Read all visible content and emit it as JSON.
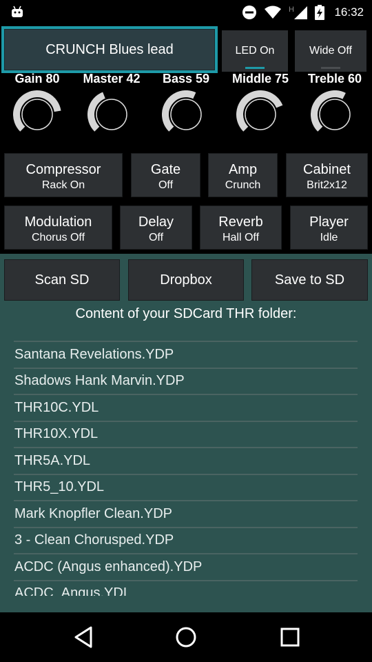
{
  "status": {
    "time": "16:32",
    "net_letter": "H"
  },
  "preset": {
    "label": "CRUNCH Blues lead"
  },
  "toggles": [
    {
      "label": "LED On",
      "indicator": "#1e9aa8"
    },
    {
      "label": "Wide Off",
      "indicator": "#4a4d50"
    }
  ],
  "knobs": [
    {
      "label": "Gain 80",
      "value": 80
    },
    {
      "label": "Master 42",
      "value": 42
    },
    {
      "label": "Bass 59",
      "value": 59
    },
    {
      "label": "Middle 75",
      "value": 75
    },
    {
      "label": "Treble 60",
      "value": 60
    }
  ],
  "effects_row1": [
    {
      "name": "Compressor",
      "value": "Rack On"
    },
    {
      "name": "Gate",
      "value": "Off"
    },
    {
      "name": "Amp",
      "value": "Crunch"
    },
    {
      "name": "Cabinet",
      "value": "Brit2x12"
    }
  ],
  "effects_row2": [
    {
      "name": "Modulation",
      "value": "Chorus Off"
    },
    {
      "name": "Delay",
      "value": "Off"
    },
    {
      "name": "Reverb",
      "value": "Hall Off"
    },
    {
      "name": "Player",
      "value": "Idle"
    }
  ],
  "sd_buttons": [
    "Scan SD",
    "Dropbox",
    "Save to SD"
  ],
  "folder_title": "Content of your SDCard THR folder:",
  "files": [
    "Santana Revelations.YDP",
    "Shadows Hank Marvin.YDP",
    "THR10C.YDL",
    "THR10X.YDL",
    "THR5A.YDL",
    "THR5_10.YDL",
    "Mark Knopfler Clean.YDP",
    "3 - Clean Chorusped.YDP",
    "ACDC (Angus enhanced).YDP",
    "ACDC_Angus.YDL"
  ],
  "colors": {
    "accent": "#1e9aa8",
    "panel": "#2d3033",
    "teal_bg": "#2d5350"
  }
}
